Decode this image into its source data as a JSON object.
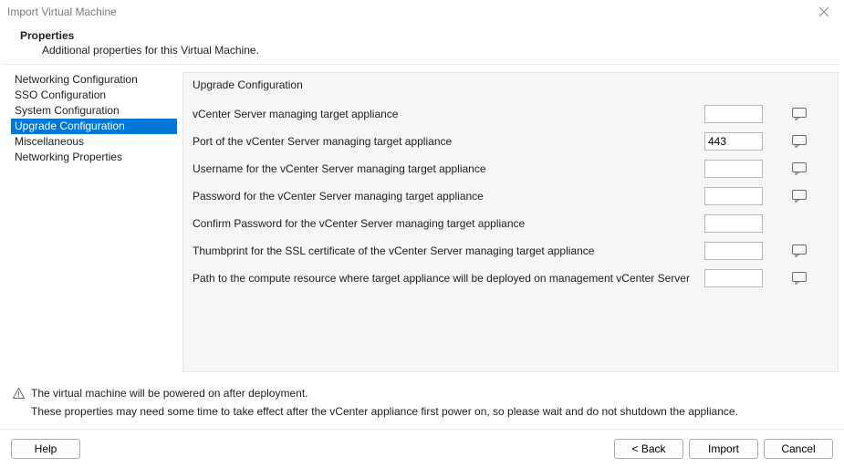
{
  "window": {
    "title": "Import Virtual Machine"
  },
  "header": {
    "title": "Properties",
    "subtitle": "Additional properties for this Virtual Machine."
  },
  "sidebar": {
    "items": [
      {
        "label": "Networking Configuration",
        "selected": false
      },
      {
        "label": "SSO Configuration",
        "selected": false
      },
      {
        "label": "System Configuration",
        "selected": false
      },
      {
        "label": "Upgrade Configuration",
        "selected": true
      },
      {
        "label": "Miscellaneous",
        "selected": false
      },
      {
        "label": "Networking Properties",
        "selected": false
      }
    ]
  },
  "content": {
    "group_title": "Upgrade Configuration",
    "rows": [
      {
        "label": "vCenter Server managing target appliance",
        "value": "",
        "has_note": true
      },
      {
        "label": "Port of the vCenter Server managing target appliance",
        "value": "443",
        "has_note": true
      },
      {
        "label": "Username for the vCenter Server managing target appliance",
        "value": "",
        "has_note": true
      },
      {
        "label": "Password for the vCenter Server managing target appliance",
        "value": "",
        "has_note": true
      },
      {
        "label": "Confirm Password for the vCenter Server managing target appliance",
        "value": "",
        "has_note": false
      },
      {
        "label": "Thumbprint for the SSL certificate of the vCenter Server managing target appliance",
        "value": "",
        "has_note": true
      },
      {
        "label": "Path to the compute resource where target appliance will be deployed on management vCenter Server",
        "value": "",
        "has_note": true
      }
    ]
  },
  "footer": {
    "info1": "The virtual machine will be powered on after deployment.",
    "info2": "These properties may need some time to take effect after the vCenter appliance first power on, so please wait and do not shutdown the appliance."
  },
  "buttons": {
    "help": "Help",
    "back": "< Back",
    "import": "Import",
    "cancel": "Cancel"
  }
}
